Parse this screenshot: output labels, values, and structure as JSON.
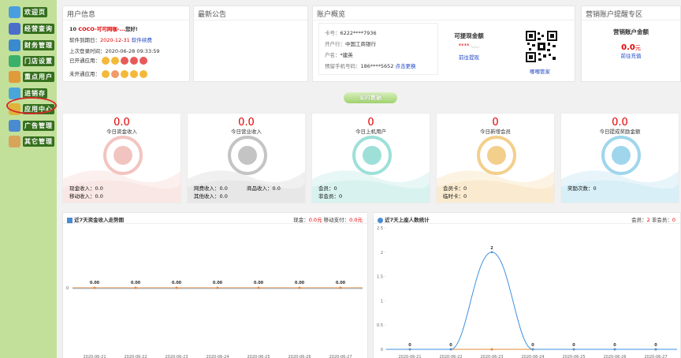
{
  "sidebar": {
    "items": [
      {
        "label": "欢迎页",
        "color": "#4a9ee0"
      },
      {
        "label": "经营查询",
        "color": "#4a6ec9"
      },
      {
        "label": "财务管理",
        "color": "#3a8ad0"
      },
      {
        "label": "门店设置",
        "color": "#3bb06a"
      },
      {
        "label": "重点用户",
        "color": "#e09a3a"
      },
      {
        "label": "进销存",
        "color": "#4aa6d8"
      },
      {
        "label": "应用中心",
        "color": "#e0b23a"
      },
      {
        "label": "广告管理",
        "color": "#4a8ad0"
      },
      {
        "label": "其它管理",
        "color": "#d8a45a"
      }
    ]
  },
  "user": {
    "title": "用户信息",
    "store": "10",
    "brand": "COCO-可可网咖-...",
    "greet": "您好!",
    "expire_label": "软件到期日：",
    "expire_value": "2020-12-31",
    "renew": "软件续费",
    "last_login_label": "上次登录时间：",
    "last_login_value": "2020-06-28 09:33:59",
    "opened_label": "已开通应用：",
    "unopened_label": "未开通应用："
  },
  "notice": {
    "title": "最新公告"
  },
  "account": {
    "title": "账户概览",
    "card_label": "卡号：",
    "card_value": "6222****7936",
    "bank_label": "开户行：",
    "bank_value": "中国工商银行",
    "name_label": "户名：",
    "name_value": "*建英",
    "phone_label": "预留手机号码：",
    "phone_value": "186****5652",
    "change": "点击更换",
    "cash_title": "可提现金额",
    "cash_stars": "****",
    "cash_link": "前往提现",
    "qr_label": "嘟嘟管家"
  },
  "marketing": {
    "title": "营销账户提醒专区",
    "sub": "营销账户金额",
    "amount": "0.0",
    "unit": "元",
    "link": "前往充值"
  },
  "realtime_btn": "实时数据",
  "cards": [
    {
      "num": "0.0",
      "label": "今日资金收入",
      "color": "#f2c4c0",
      "lines": [
        {
          "k": "现金收入：",
          "v": "0.0"
        },
        {
          "k": "移动收入：",
          "v": "0.0"
        }
      ]
    },
    {
      "num": "0.0",
      "label": "今日营业收入",
      "color": "#c4c4c4",
      "lines": [
        {
          "k": "网费收入：",
          "v": "0.0"
        },
        {
          "k": "其他收入：",
          "v": "0.0"
        },
        {
          "k": "商品收入：",
          "v": "0.0"
        }
      ]
    },
    {
      "num": "0",
      "label": "今日上机用户",
      "color": "#9ee0d8",
      "lines": [
        {
          "k": "会员：",
          "v": "0"
        },
        {
          "k": "非会员：",
          "v": "0"
        }
      ]
    },
    {
      "num": "0",
      "label": "今日新增会员",
      "color": "#f3cf8c",
      "lines": [
        {
          "k": "会员卡：",
          "v": "0"
        },
        {
          "k": "临时卡：",
          "v": "0"
        }
      ]
    },
    {
      "num": "0.0",
      "label": "今日提成奖励金额",
      "color": "#9fd6ec",
      "lines": [
        {
          "k": "奖励次数：",
          "v": "0"
        }
      ]
    }
  ],
  "chart1": {
    "title": "近7天资金收入走势图",
    "legend_cash": "现金：",
    "cash_v": "0.0",
    "unit": "元",
    "legend_mobile": "移动支付：",
    "mobile_v": "0.0"
  },
  "chart2": {
    "title": "近7天上座人数统计",
    "legend_member": "会员：",
    "member_v": "2",
    "legend_non": "非会员：",
    "non_v": "0"
  },
  "chart_data": [
    {
      "type": "line",
      "title": "近7天资金收入走势图",
      "categories": [
        "2020-06-21",
        "2020-06-22",
        "2020-06-23",
        "2020-06-24",
        "2020-06-25",
        "2020-06-26",
        "2020-06-27"
      ],
      "series": [
        {
          "name": "现金",
          "values": [
            0,
            0,
            0,
            0,
            0,
            0,
            0
          ]
        },
        {
          "name": "移动支付",
          "values": [
            0,
            0,
            0,
            0,
            0,
            0,
            0
          ]
        }
      ],
      "yticks": [
        "0"
      ],
      "data_labels": [
        "0.00",
        "0.00",
        "0.00",
        "0.00",
        "0.00",
        "0.00",
        "0.00"
      ]
    },
    {
      "type": "line",
      "title": "近7天上座人数统计",
      "categories": [
        "2020-06-21",
        "2020-06-22",
        "2020-06-23",
        "2020-06-24",
        "2020-06-25",
        "2020-06-26",
        "2020-06-27"
      ],
      "series": [
        {
          "name": "会员",
          "values": [
            0,
            0,
            2,
            0,
            0,
            0,
            0
          ]
        },
        {
          "name": "非会员",
          "values": [
            0,
            0,
            0,
            0,
            0,
            0,
            0
          ]
        }
      ],
      "yticks": [
        "0",
        "0.5",
        "1",
        "1.5",
        "2",
        "2.5"
      ],
      "ylim": [
        0,
        2.5
      ],
      "data_labels": [
        "0",
        "0",
        "2",
        "0",
        "0",
        "0",
        "0"
      ]
    }
  ]
}
